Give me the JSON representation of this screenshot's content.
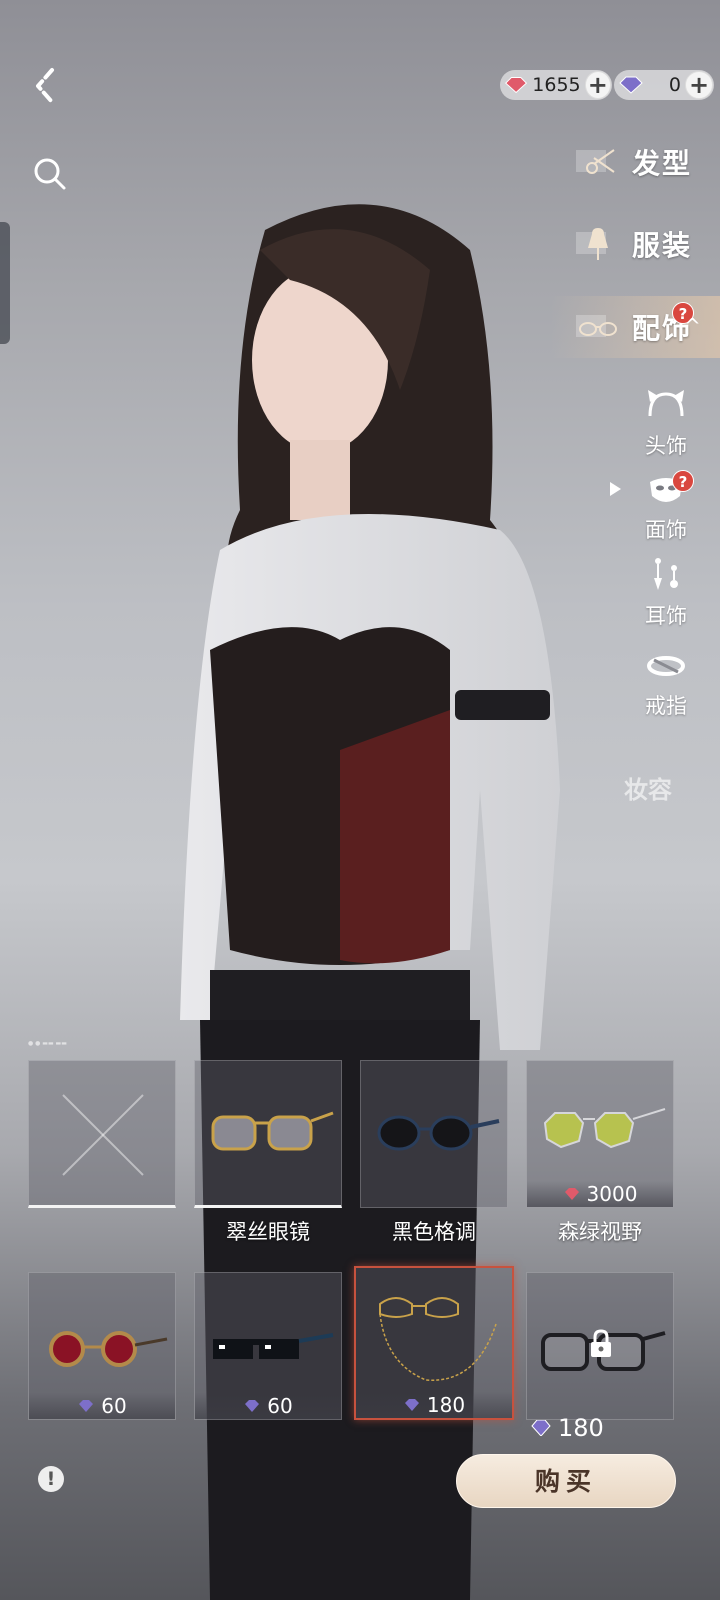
{
  "top_bar": {
    "red_gems": "1655",
    "blue_gems": "0",
    "plus": "+"
  },
  "categories": [
    {
      "label": "发型",
      "icon": "scissors-icon"
    },
    {
      "label": "服装",
      "icon": "mannequin-icon"
    },
    {
      "label": "配饰",
      "icon": "glasses-icon",
      "badge": "?",
      "chevron": "^"
    }
  ],
  "subcategories": [
    {
      "label": "头饰",
      "icon": "cat-ears-icon"
    },
    {
      "label": "面饰",
      "icon": "mask-icon",
      "badge": "?"
    },
    {
      "label": "耳饰",
      "icon": "earring-icon"
    },
    {
      "label": "戒指",
      "icon": "ring-icon"
    }
  ],
  "partial_category": "妆容",
  "items_row1": [
    {
      "name": "",
      "price": ""
    },
    {
      "name": "翠丝眼镜",
      "price": ""
    },
    {
      "name": "黑色格调",
      "price": ""
    },
    {
      "name": "森绿视野",
      "price": "3000"
    }
  ],
  "items_row2": [
    {
      "name": "",
      "price": "60"
    },
    {
      "name": "",
      "price": "60"
    },
    {
      "name": "",
      "price": "180"
    },
    {
      "name": "",
      "price": ""
    }
  ],
  "total_price": "180",
  "buy_label": "购买",
  "info_label": "!",
  "colors": {
    "accent_selected": "#c7523e",
    "buy_button": "#efe0cf",
    "badge": "#d9473f"
  }
}
